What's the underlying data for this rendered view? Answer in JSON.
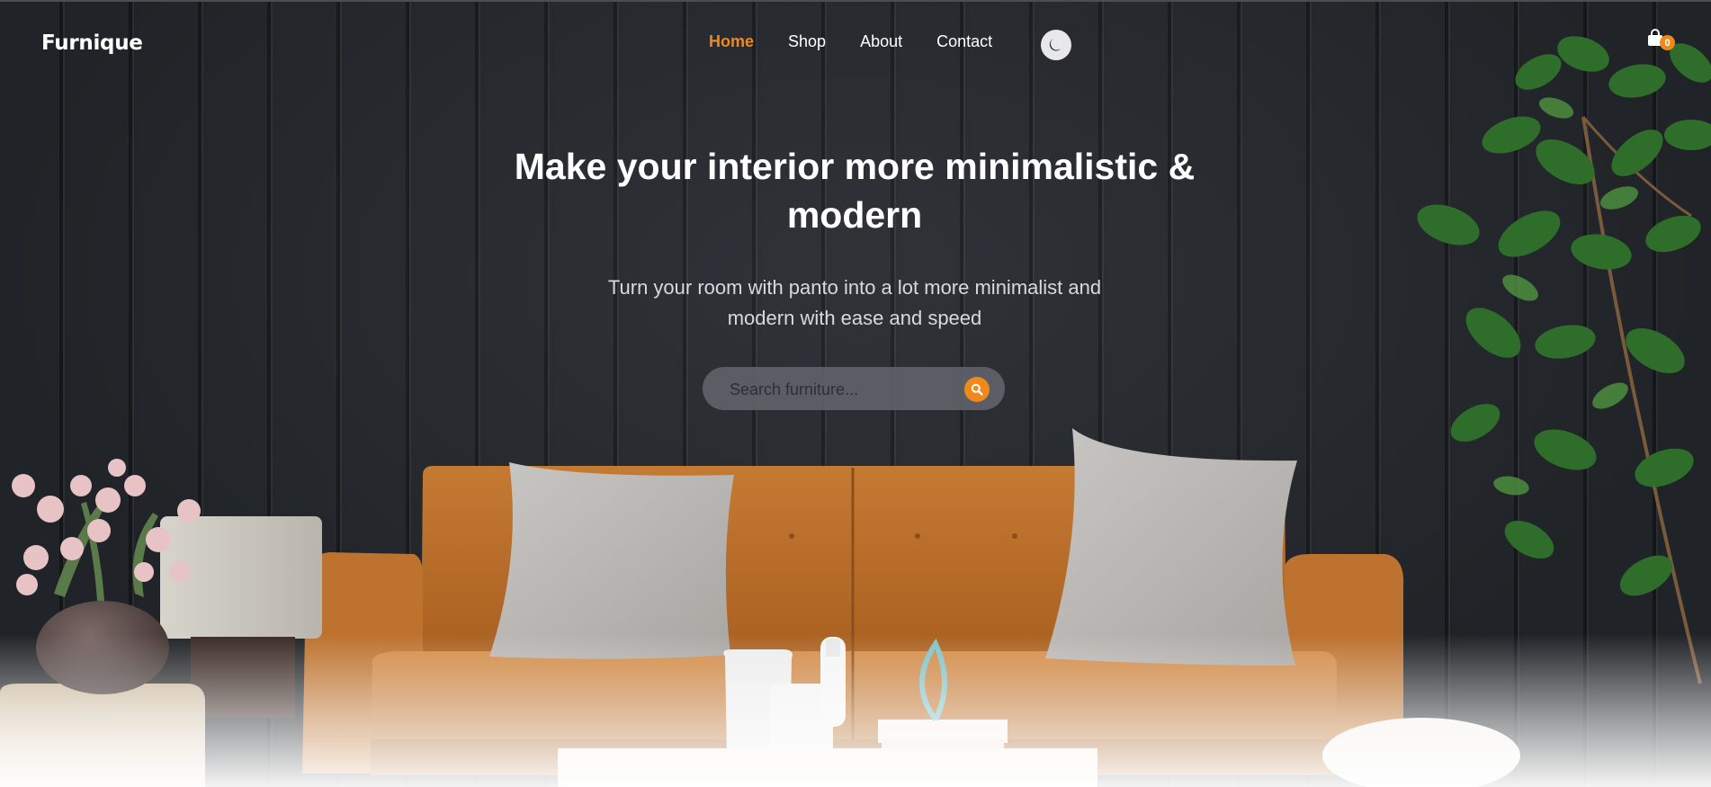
{
  "navbar": {
    "logo": "Furnique",
    "links": [
      {
        "label": "Home",
        "active": true
      },
      {
        "label": "Shop",
        "active": false
      },
      {
        "label": "About",
        "active": false
      },
      {
        "label": "Contact",
        "active": false
      }
    ],
    "theme_toggle_icon": "moon-icon",
    "cart_icon": "shopping-bag-icon",
    "cart_count": "0"
  },
  "hero": {
    "headline": "Make your interior more minimalistic & modern",
    "subtitle": "Turn your room with panto into a lot more minimalist and modern with ease and speed",
    "search": {
      "placeholder": "Search furniture...",
      "value": "",
      "button_icon": "search-icon"
    }
  },
  "colors": {
    "accent": "#f0891c",
    "wall": "#2c3035",
    "text": "#ffffff"
  }
}
